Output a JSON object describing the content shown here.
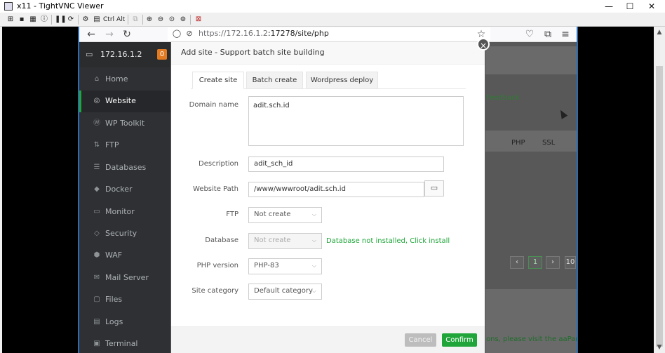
{
  "window": {
    "title": "x11 - TightVNC Viewer",
    "minimize": "—",
    "maximize": "☐",
    "close": "✕"
  },
  "vnc_toolbar": {
    "ctrl_label": "Ctrl",
    "alt_label": "Alt"
  },
  "browser": {
    "url_host": "https://172.16.1.2",
    "url_path": ":17278/site/php"
  },
  "sidebar": {
    "server_ip": "172.16.1.2",
    "badge": "0",
    "items": [
      {
        "label": "Home",
        "icon": "home-icon",
        "glyph": "⌂"
      },
      {
        "label": "Website",
        "icon": "globe-icon",
        "glyph": "◎"
      },
      {
        "label": "WP Toolkit",
        "icon": "wordpress-icon",
        "glyph": "Ⓦ"
      },
      {
        "label": "FTP",
        "icon": "ftp-icon",
        "glyph": "⇅"
      },
      {
        "label": "Databases",
        "icon": "database-icon",
        "glyph": "☰"
      },
      {
        "label": "Docker",
        "icon": "docker-icon",
        "glyph": "◆"
      },
      {
        "label": "Monitor",
        "icon": "monitor-icon",
        "glyph": "▭"
      },
      {
        "label": "Security",
        "icon": "shield-icon",
        "glyph": "◇"
      },
      {
        "label": "WAF",
        "icon": "waf-icon",
        "glyph": "⬢"
      },
      {
        "label": "Mail Server",
        "icon": "mail-icon",
        "glyph": "✉"
      },
      {
        "label": "Files",
        "icon": "folder-icon",
        "glyph": "▢"
      },
      {
        "label": "Logs",
        "icon": "logs-icon",
        "glyph": "▤"
      },
      {
        "label": "Terminal",
        "icon": "terminal-icon",
        "glyph": "▣"
      }
    ]
  },
  "background": {
    "feedback": "Feedback",
    "col_php": "PHP",
    "col_ssl": "SSL",
    "page_current": "1",
    "page_size": "10",
    "footer_text": "ons, please visit the aaPanel Fo"
  },
  "modal": {
    "title": "Add site - Support batch site building",
    "tabs": [
      "Create site",
      "Batch create",
      "Wordpress deploy"
    ],
    "domain_label": "Domain name",
    "domain_value": "adit.sch.id",
    "description_label": "Description",
    "description_value": "adit_sch_id",
    "path_label": "Website Path",
    "path_value": "/www/wwwroot/adit.sch.id",
    "ftp_label": "FTP",
    "ftp_value": "Not create",
    "database_label": "Database",
    "database_value": "Not create",
    "database_hint": "Database not installed, Click install",
    "php_label": "PHP version",
    "php_value": "PHP-83",
    "category_label": "Site category",
    "category_value": "Default category",
    "cancel": "Cancel",
    "confirm": "Confirm"
  },
  "colors": {
    "accent": "#20a53a",
    "sidebar": "#2e3033",
    "badge": "#e27a22",
    "vnc_border": "#2b6cb5"
  }
}
